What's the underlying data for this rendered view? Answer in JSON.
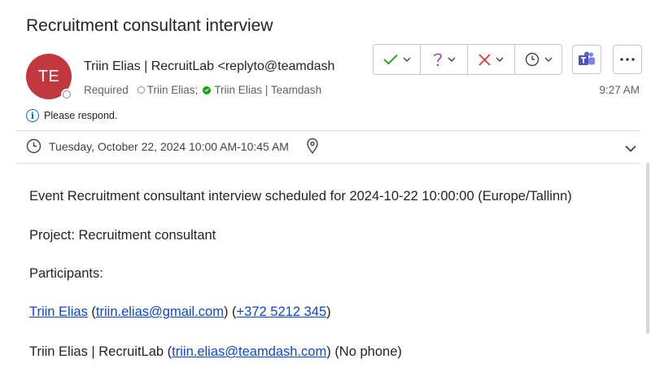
{
  "subject": "Recruitment consultant interview",
  "avatar_initials": "TE",
  "sender": "Triin Elias | RecruitLab <replyto@teamdash",
  "required_label": "Required",
  "attendees": [
    "Triin Elias;",
    "Triin Elias | Teamdash"
  ],
  "time": "9:27 AM",
  "respond_text": "Please respond.",
  "datetime": "Tuesday, October 22, 2024 10:00 AM-10:45 AM",
  "colors": {
    "avatar": "#c2383f",
    "accept": "#13a10e",
    "decline": "#d13438",
    "tentative": "#8a3ea8",
    "teams": "#5b5fc7",
    "link": "#0b46d9"
  },
  "body": {
    "event_line": "Event Recruitment consultant interview scheduled for 2024-10-22 10:00:00 (Europe/Tallinn)",
    "project_line": "Project: Recruitment consultant",
    "participants_heading": "Participants:",
    "p1": {
      "name": "Triin Elias",
      "open": " (",
      "email": "triin.elias@gmail.com",
      "mid": ") (",
      "phone": "+372 5212 345",
      "close": ")"
    },
    "p2": {
      "name": "Triin Elias | RecruitLab (",
      "email": "triin.elias@teamdash.com",
      "suffix": ") (No phone)"
    }
  }
}
